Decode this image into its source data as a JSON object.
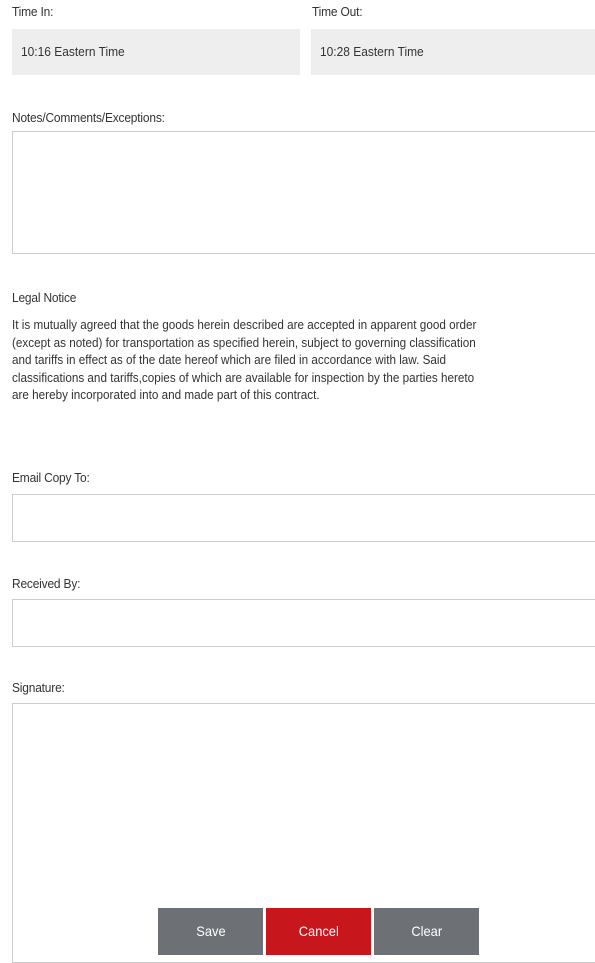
{
  "time_in": {
    "label": "Time In:",
    "value": "10:16 Eastern Time"
  },
  "time_out": {
    "label": "Time Out:",
    "value": "10:28 Eastern Time"
  },
  "notes": {
    "label": "Notes/Comments/Exceptions:",
    "value": ""
  },
  "legal_notice": {
    "heading": "Legal Notice",
    "lines": [
      "It is mutually agreed that the goods herein described are accepted in apparent good order",
      "(except as noted) for transportation as specified herein, subject to governing classification",
      "and tariffs in effect as of the date hereof which are filed in accordance with law. Said",
      "classifications and tariffs,copies of which are available for inspection by the parties hereto",
      "are hereby incorporated into and made part of this contract."
    ]
  },
  "email_copy": {
    "label": "Email Copy To:",
    "value": ""
  },
  "received_by": {
    "label": "Received By:",
    "value": ""
  },
  "signature": {
    "label": "Signature:"
  },
  "buttons": {
    "save": "Save",
    "cancel": "Cancel",
    "clear": "Clear"
  },
  "colors": {
    "button_gray": "#6d7175",
    "button_red": "#c8161d",
    "readonly_bg": "#eeeeee",
    "border": "#cccccc"
  }
}
